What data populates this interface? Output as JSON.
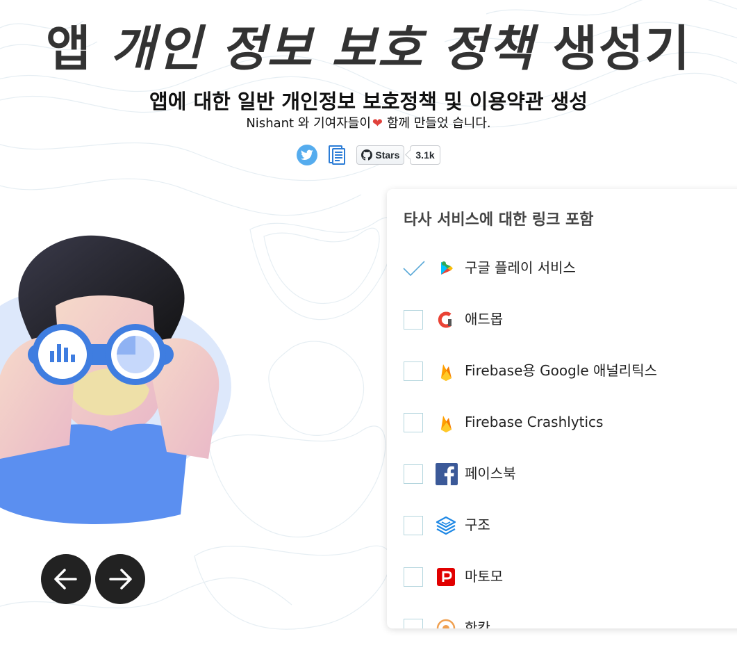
{
  "header": {
    "title_part1": "앱",
    "title_part2": "개인 정보 보호 정책",
    "title_part3": "생성기",
    "subtitle": "앱에 대한 일반 개인정보 보호정책 및 이용약관 생성",
    "credits_before": "Nishant 와 기여자들이",
    "credits_after": "함께 만들었 습니다."
  },
  "badges": {
    "github_stars_label": "Stars",
    "github_stars_count": "3.1k"
  },
  "services_card": {
    "title": "타사 서비스에 대한 링크 포함",
    "items": [
      {
        "label": "구글 플레이 서비스",
        "checked": true,
        "icon": "google-play-icon"
      },
      {
        "label": "애드몹",
        "checked": false,
        "icon": "admob-icon"
      },
      {
        "label": "Firebase용 Google 애널리틱스",
        "checked": false,
        "icon": "firebase-icon"
      },
      {
        "label": "Firebase Crashlytics",
        "checked": false,
        "icon": "firebase-icon"
      },
      {
        "label": "페이스북",
        "checked": false,
        "icon": "facebook-icon"
      },
      {
        "label": "구조",
        "checked": false,
        "icon": "fabric-icon"
      },
      {
        "label": "마토모",
        "checked": false,
        "icon": "matomo-icon"
      },
      {
        "label": "한칸",
        "checked": false,
        "icon": "clicky-icon"
      }
    ]
  },
  "colors": {
    "accent_blue": "#55acee",
    "dark_button": "#222222",
    "check_color": "#5aa9d8",
    "illustration_blue": "#5b8ff0"
  }
}
